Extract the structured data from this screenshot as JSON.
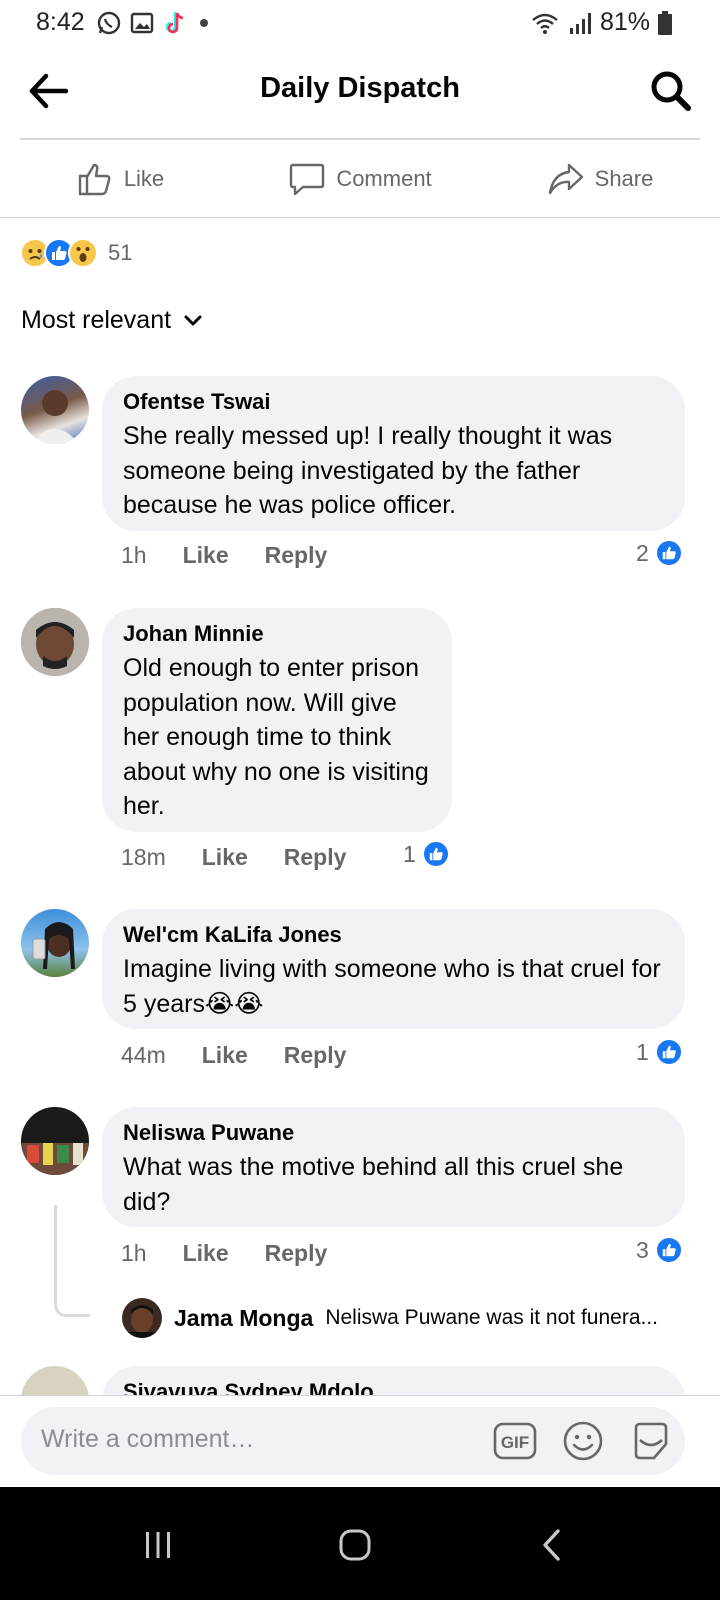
{
  "status_bar": {
    "time": "8:42",
    "battery": "81%",
    "icons": [
      "whatsapp-icon",
      "gallery-icon",
      "tiktok-icon",
      "dot-icon",
      "wifi-icon",
      "signal-icon",
      "battery-icon"
    ]
  },
  "header": {
    "title": "Daily Dispatch"
  },
  "actions": {
    "like": "Like",
    "comment": "Comment",
    "share": "Share"
  },
  "reactions": {
    "types": [
      "sad",
      "like",
      "wow"
    ],
    "count": "51"
  },
  "sort": {
    "label": "Most relevant"
  },
  "comments": [
    {
      "author": "Ofentse Tswai",
      "text": "She really messed up! I really thought it was someone being investigated by the father because he was police officer.",
      "time": "1h",
      "like": "Like",
      "reply": "Reply",
      "likes": "2"
    },
    {
      "author": "Johan Minnie",
      "text": "Old enough to enter prison population now. Will give her enough time to think about why no one is visiting her.",
      "time": "18m",
      "like": "Like",
      "reply": "Reply",
      "likes": "1"
    },
    {
      "author": "Wel'cm KaLifa Jones",
      "text": "Imagine living with someone who is that cruel for 5 years😭😭",
      "time": "44m",
      "like": "Like",
      "reply": "Reply",
      "likes": "1"
    },
    {
      "author": "Neliswa Puwane",
      "text": "What was the motive behind all this cruel she did?",
      "time": "1h",
      "like": "Like",
      "reply": "Reply",
      "likes": "3",
      "reply_preview": {
        "author": "Jama Monga",
        "text": "Neliswa Puwane was it not funera..."
      }
    },
    {
      "author": "Sivavuva Sydney Mdolo"
    }
  ],
  "composer": {
    "placeholder": "Write a comment…",
    "gif": "GIF"
  },
  "colors": {
    "accent": "#1877f2",
    "bubble": "#f0f2f5",
    "secondary_text": "#65676b"
  }
}
